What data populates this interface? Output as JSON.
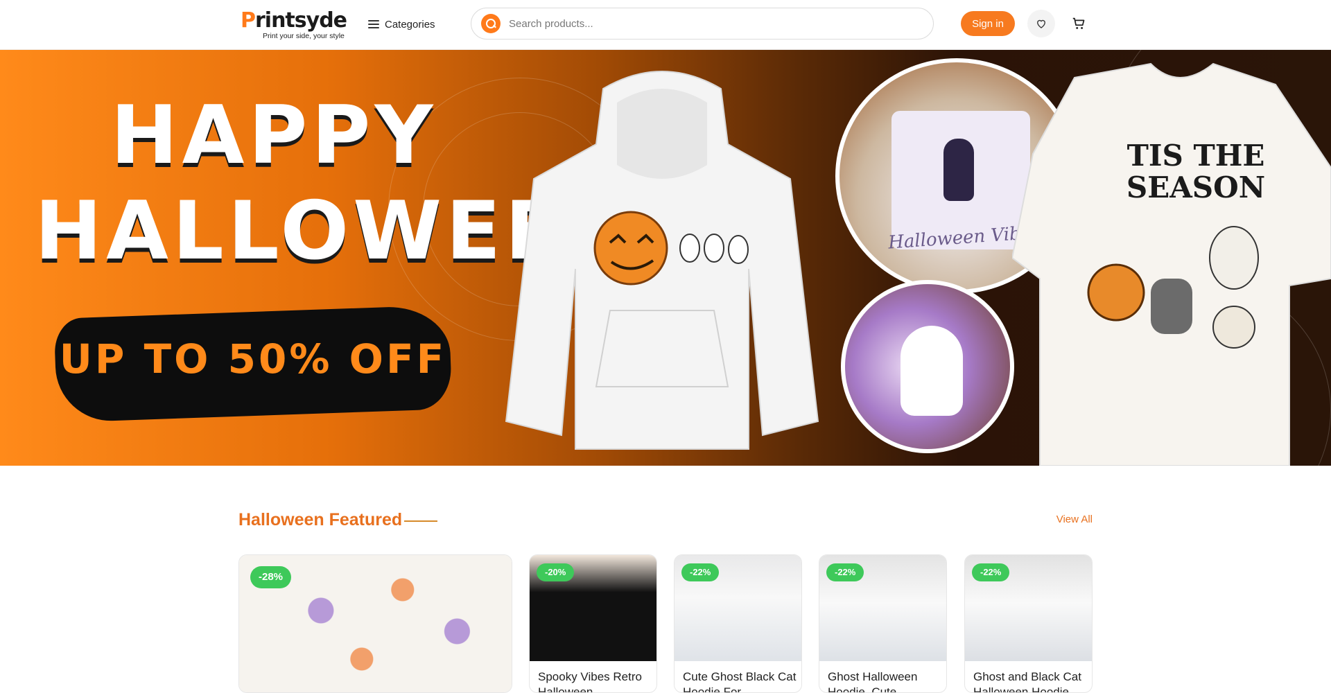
{
  "header": {
    "logo_word_p": "P",
    "logo_word_rest": "rintsyde",
    "logo_tagline": "Print your side, your style",
    "categories_label": "Categories",
    "search_placeholder": "Search products...",
    "signin_label": "Sign in"
  },
  "hero": {
    "title_line1": "HAPPY",
    "title_line2": "HALLOWEEN",
    "promo": "UP TO 50% OFF",
    "mug_text": "Halloween Vibes",
    "tee_text_line1": "TIS THE",
    "tee_text_line2": "SEASON",
    "slides": 6,
    "active_slide": 1
  },
  "featured": {
    "title": "Halloween Featured",
    "view_all": "View All",
    "products": [
      {
        "badge": "-28%",
        "title": ""
      },
      {
        "badge": "-20%",
        "title": "Spooky Vibes Retro Halloween"
      },
      {
        "badge": "-22%",
        "title": "Cute Ghost Black Cat Hoodie For"
      },
      {
        "badge": "-22%",
        "title": "Ghost Halloween Hoodie, Cute"
      },
      {
        "badge": "-22%",
        "title": "Ghost and Black Cat Halloween Hoodie"
      }
    ]
  },
  "colors": {
    "brand_orange": "#f77a1f",
    "badge_green": "#3ec95a"
  },
  "icons": [
    "menu-icon",
    "search-icon",
    "heart-icon",
    "cart-icon"
  ]
}
